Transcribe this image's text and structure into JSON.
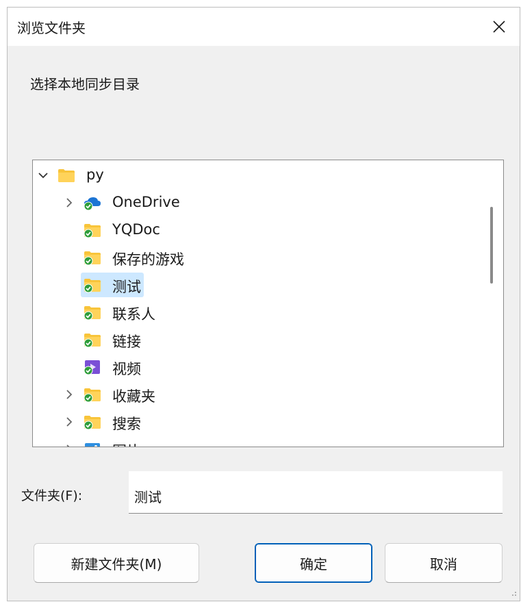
{
  "dialog": {
    "title": "浏览文件夹",
    "prompt": "选择本地同步目录",
    "folder_label": "文件夹(F):",
    "folder_value": "测试"
  },
  "tree": {
    "items": [
      {
        "label": "py",
        "icon": "folder-icon",
        "expand": "expanded",
        "level": 0
      },
      {
        "label": "OneDrive",
        "icon": "onedrive-cloud-icon",
        "expand": "collapsed",
        "level": 1
      },
      {
        "label": "YQDoc",
        "icon": "synced-folder-icon",
        "expand": "none",
        "level": 1
      },
      {
        "label": "保存的游戏",
        "icon": "synced-folder-icon",
        "expand": "none",
        "level": 1
      },
      {
        "label": "测试",
        "icon": "synced-folder-icon",
        "expand": "none",
        "level": 1,
        "selected": true
      },
      {
        "label": "联系人",
        "icon": "synced-folder-icon",
        "expand": "none",
        "level": 1
      },
      {
        "label": "链接",
        "icon": "synced-folder-icon",
        "expand": "none",
        "level": 1
      },
      {
        "label": "视频",
        "icon": "synced-video-folder-icon",
        "expand": "none",
        "level": 1
      },
      {
        "label": "收藏夹",
        "icon": "synced-folder-icon",
        "expand": "collapsed",
        "level": 1
      },
      {
        "label": "搜索",
        "icon": "synced-folder-icon",
        "expand": "collapsed",
        "level": 1
      },
      {
        "label": "图片",
        "icon": "synced-pictures-folder-icon",
        "expand": "collapsed",
        "level": 1
      }
    ]
  },
  "buttons": {
    "new_folder": "新建文件夹(M)",
    "ok": "确定",
    "cancel": "取消"
  },
  "colors": {
    "accent": "#005fb8",
    "selection": "#cde8ff",
    "folder": "#f8c43a",
    "sync_check": "#2f9e3a",
    "onedrive": "#1b74d4"
  }
}
